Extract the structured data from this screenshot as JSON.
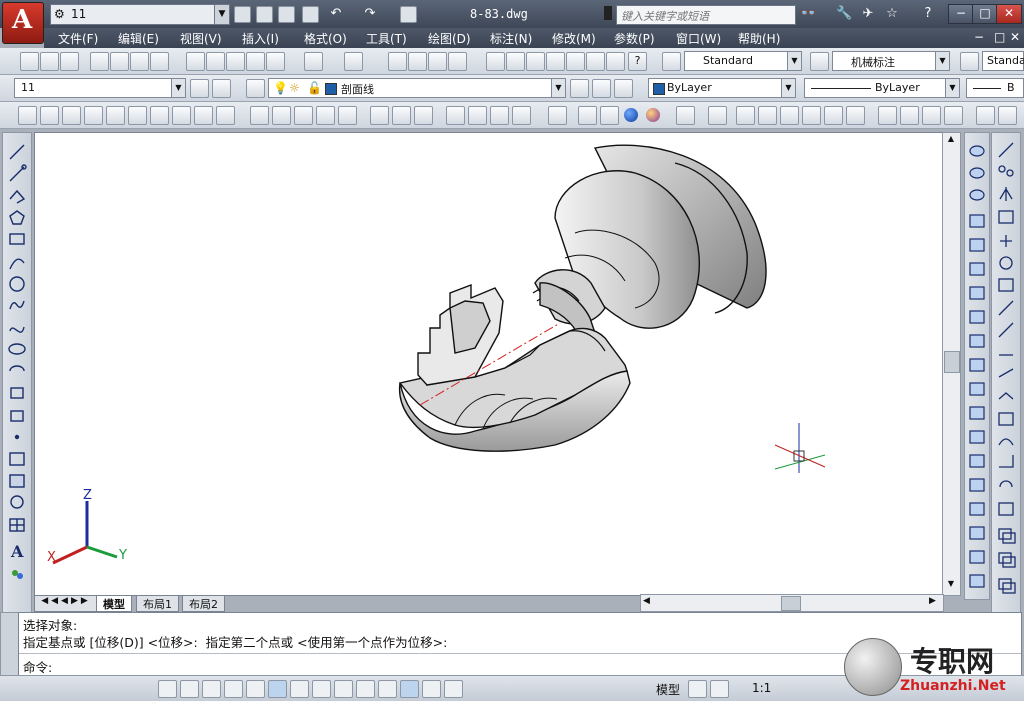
{
  "app": {
    "logo_letter": "A",
    "workspace": "11",
    "document_title": "8-83.dwg",
    "search_placeholder": "键入关键字或短语",
    "accent_color": "#c0392b",
    "window_buttons": [
      "−",
      "□",
      "✕"
    ],
    "doc_window_buttons": [
      "−",
      "□",
      "✕"
    ]
  },
  "menu": {
    "items": [
      "文件(F)",
      "编辑(E)",
      "视图(V)",
      "插入(I)",
      "格式(O)",
      "工具(T)",
      "绘图(D)",
      "标注(N)",
      "修改(M)",
      "参数(P)",
      "窗口(W)",
      "帮助(H)"
    ]
  },
  "toolbar": {
    "text_style": "Standard",
    "dim_style": "机械标注",
    "table_style": "Standa",
    "layer_state": "11",
    "current_layer": "剖面线",
    "color": "ByLayer",
    "linetype": "ByLayer",
    "lineweight": "B"
  },
  "layout_tabs": {
    "items": [
      "模型",
      "布局1",
      "布局2"
    ],
    "active": "模型"
  },
  "command": {
    "history": [
      "选择对象:",
      "指定基点或 [位移(D)] <位移>:  指定第二个点或 <使用第一个点作为位移>:"
    ],
    "prompt": "命令:"
  },
  "ucs": {
    "x": "X",
    "y": "Y",
    "z": "Z"
  },
  "status": {
    "space": "模型",
    "scale": "1:1"
  },
  "watermark": {
    "text_cn": "专职网",
    "text_url": "Zhuanzhi.Net"
  }
}
